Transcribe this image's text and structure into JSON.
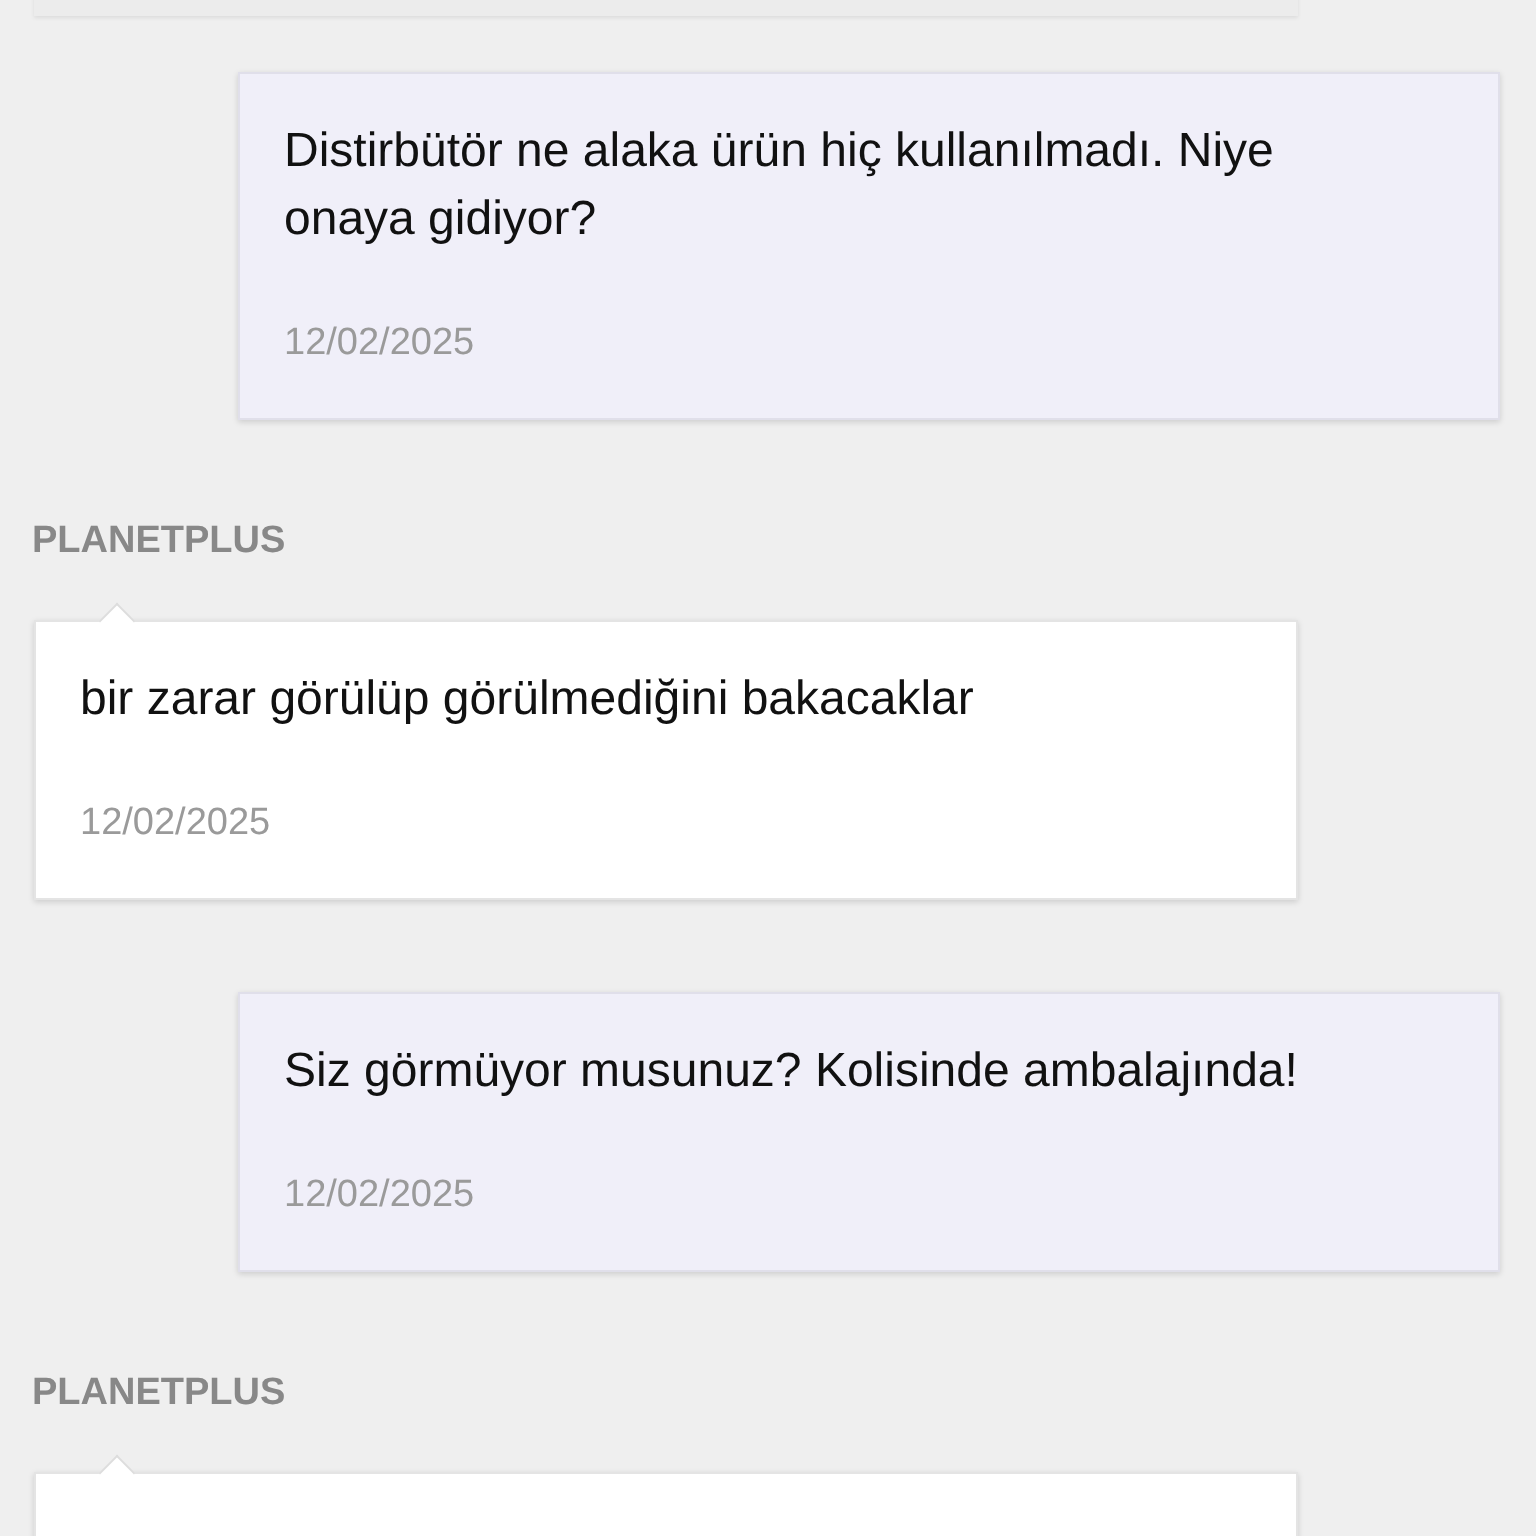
{
  "messages": [
    {
      "kind": "outgoing",
      "text": "Distirbütör ne alaka ürün hiç kullanılmadı. Niye onaya gidiyor?",
      "date": "12/02/2025"
    },
    {
      "kind": "incoming",
      "sender": "PLANETPLUS",
      "text": "bir zarar görülüp görülmediğini bakacaklar",
      "date": "12/02/2025"
    },
    {
      "kind": "outgoing",
      "text": "Siz görmüyor musunuz? Kolisinde ambalajında!",
      "date": "12/02/2025"
    }
  ],
  "next_sender": "PLANETPLUS"
}
